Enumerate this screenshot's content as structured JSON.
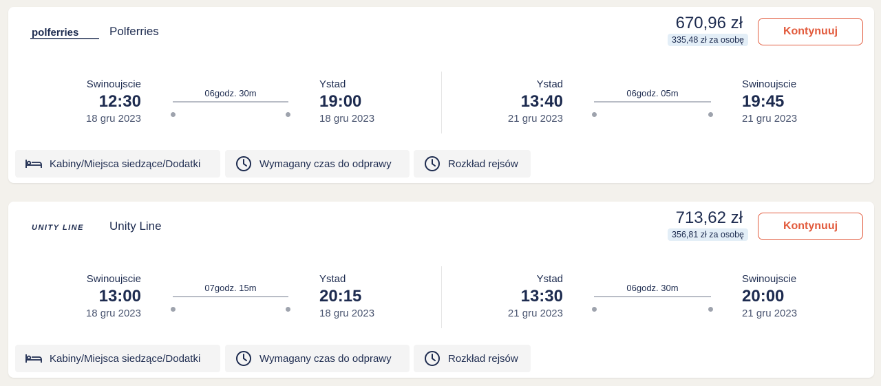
{
  "results": [
    {
      "operator": "Polferries",
      "logo_text": "polferries",
      "price": "670,96 zł",
      "per_person": "335,48 zł za osobę",
      "cta": "Kontynuuj",
      "outbound": {
        "from": "Swinoujscie",
        "dep_time": "12:30",
        "dep_date": "18 gru 2023",
        "duration": "06godz. 30m",
        "to": "Ystad",
        "arr_time": "19:00",
        "arr_date": "18 gru 2023"
      },
      "return": {
        "from": "Ystad",
        "dep_time": "13:40",
        "dep_date": "21 gru 2023",
        "duration": "06godz. 05m",
        "to": "Swinoujscie",
        "arr_time": "19:45",
        "arr_date": "21 gru 2023"
      },
      "actions": [
        "Kabiny/Miejsca siedzące/Dodatki",
        "Wymagany czas do odprawy",
        "Rozkład rejsów"
      ]
    },
    {
      "operator": "Unity Line",
      "logo_text": "UNITY LINE",
      "price": "713,62 zł",
      "per_person": "356,81 zł za osobę",
      "cta": "Kontynuuj",
      "outbound": {
        "from": "Swinoujscie",
        "dep_time": "13:00",
        "dep_date": "18 gru 2023",
        "duration": "07godz. 15m",
        "to": "Ystad",
        "arr_time": "20:15",
        "arr_date": "18 gru 2023"
      },
      "return": {
        "from": "Ystad",
        "dep_time": "13:30",
        "dep_date": "21 gru 2023",
        "duration": "06godz. 30m",
        "to": "Swinoujscie",
        "arr_time": "20:00",
        "arr_date": "21 gru 2023"
      },
      "actions": [
        "Kabiny/Miejsca siedzące/Dodatki",
        "Wymagany czas do odprawy",
        "Rozkład rejsów"
      ]
    }
  ],
  "icons": [
    "bed-icon",
    "clock-icon",
    "clock-icon"
  ],
  "colors": {
    "accent": "#e25a3c",
    "text": "#1d2b4f",
    "badge_bg": "#e3eef7"
  }
}
